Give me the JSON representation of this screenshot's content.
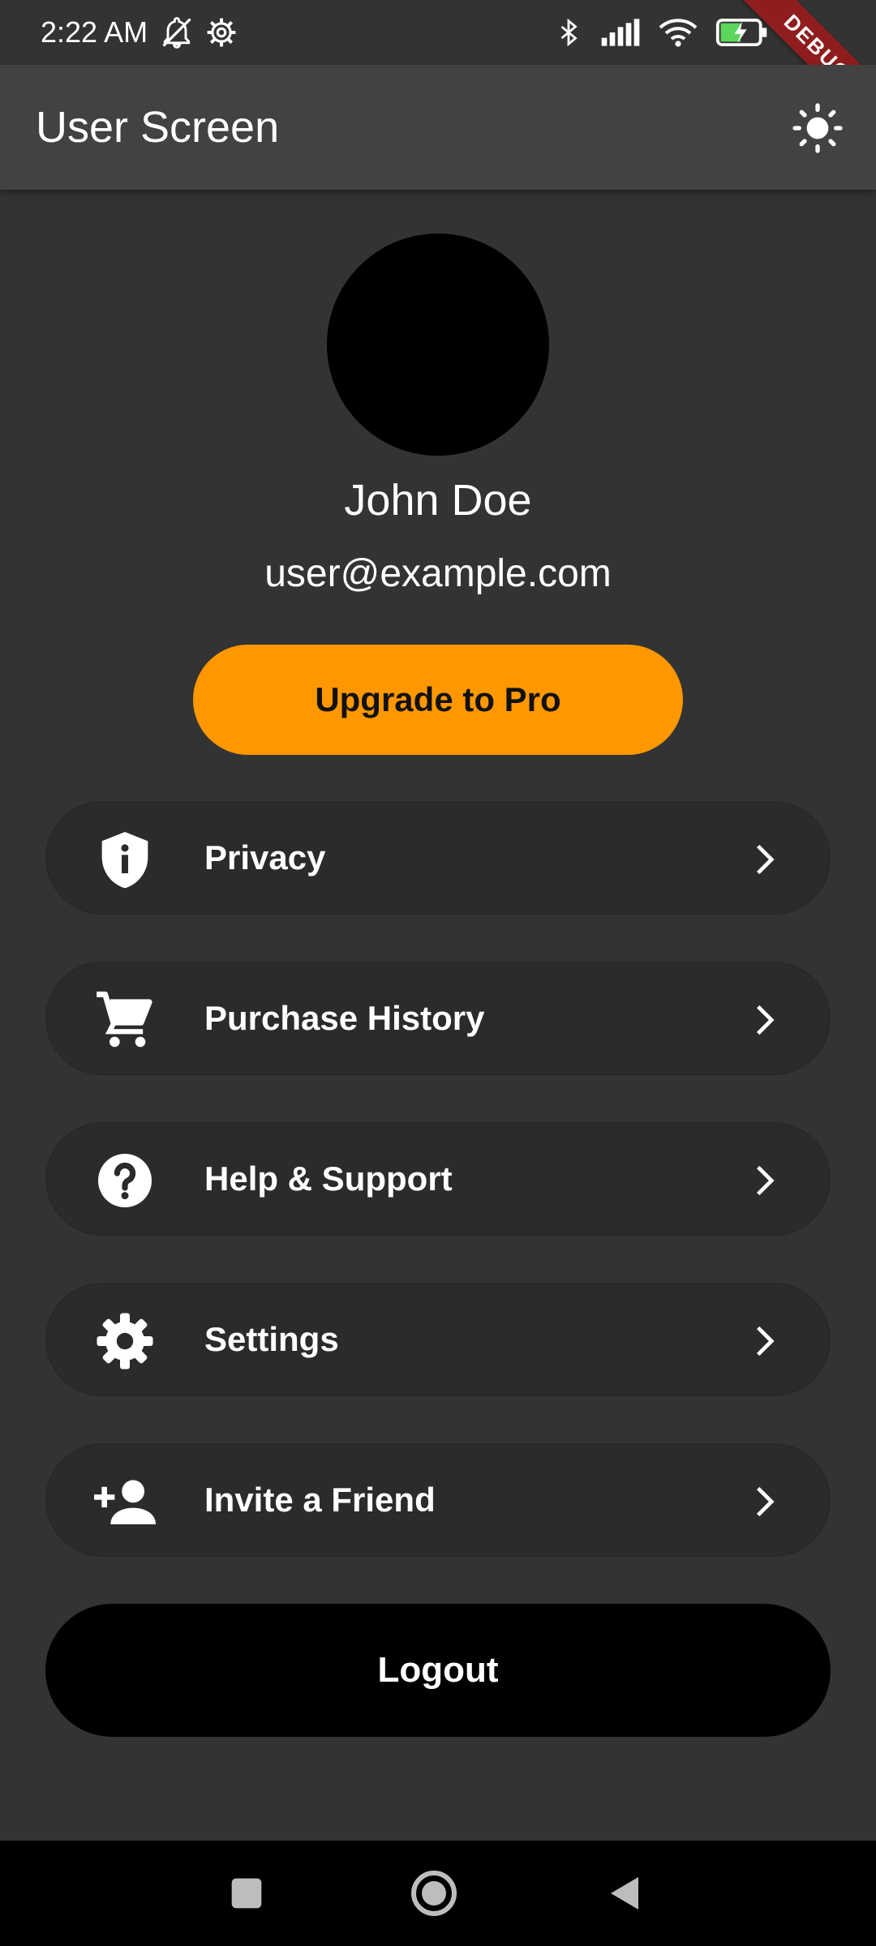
{
  "status_bar": {
    "time": "2:22 AM",
    "battery": "54",
    "icons": [
      "silent-bell-icon",
      "settings-cog-icon",
      "bluetooth-icon",
      "signal-icon",
      "wifi-icon",
      "battery-charging-icon"
    ]
  },
  "debug_banner": "DEBUG",
  "app_bar": {
    "title": "User Screen",
    "action_icon": "sun-icon"
  },
  "profile": {
    "name": "John Doe",
    "email": "user@example.com"
  },
  "upgrade_label": "Upgrade to Pro",
  "menu": [
    {
      "label": "Privacy",
      "icon": "shield-info-icon"
    },
    {
      "label": "Purchase History",
      "icon": "cart-icon"
    },
    {
      "label": "Help & Support",
      "icon": "help-icon"
    },
    {
      "label": "Settings",
      "icon": "gear-icon"
    },
    {
      "label": "Invite a Friend",
      "icon": "person-add-icon"
    }
  ],
  "logout_label": "Logout",
  "colors": {
    "background": "#333333",
    "app_bar": "#424242",
    "accent": "#ff9800",
    "menu_item": "#2b2b2b",
    "logout": "#000000",
    "debug": "#8f1d1d"
  },
  "nav_bar": {
    "icons": [
      "recents-square-icon",
      "home-circle-icon",
      "back-triangle-icon"
    ]
  }
}
